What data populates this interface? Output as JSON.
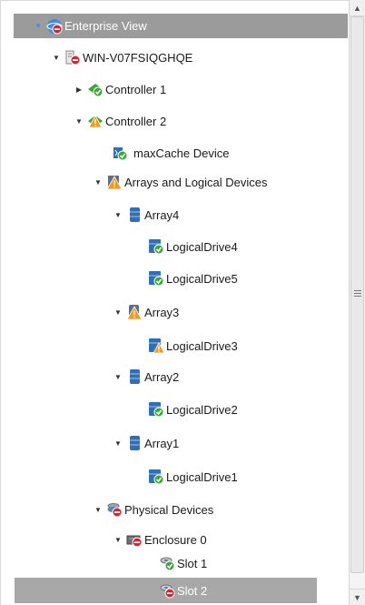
{
  "tree": {
    "root": {
      "label": "Enterprise View",
      "icon": "enterprise-view-icon"
    },
    "server": {
      "label": "WIN-V07FSIQGHQE",
      "icon": "server-error-icon"
    },
    "controller1": {
      "label": "Controller 1",
      "icon": "controller-ok-icon"
    },
    "controller2": {
      "label": "Controller 2",
      "icon": "controller-warning-icon"
    },
    "maxcache": {
      "label": "maxCache Device",
      "icon": "maxcache-device-icon"
    },
    "arrays_group": {
      "label": "Arrays and Logical Devices",
      "icon": "arrays-warning-icon"
    },
    "array4": {
      "label": "Array4",
      "icon": "array-icon"
    },
    "ld4": {
      "label": "LogicalDrive4",
      "icon": "logical-drive-ok-icon"
    },
    "ld5": {
      "label": "LogicalDrive5",
      "icon": "logical-drive-ok-icon"
    },
    "array3": {
      "label": "Array3",
      "icon": "array-warning-icon"
    },
    "ld3": {
      "label": "LogicalDrive3",
      "icon": "logical-drive-warning-icon"
    },
    "array2": {
      "label": "Array2",
      "icon": "array-icon"
    },
    "ld2": {
      "label": "LogicalDrive2",
      "icon": "logical-drive-ok-icon"
    },
    "array1": {
      "label": "Array1",
      "icon": "array-icon"
    },
    "ld1": {
      "label": "LogicalDrive1",
      "icon": "logical-drive-ok-icon"
    },
    "physical": {
      "label": "Physical Devices",
      "icon": "physical-devices-error-icon"
    },
    "enclosure0": {
      "label": "Enclosure 0",
      "icon": "enclosure-error-icon"
    },
    "slot1": {
      "label": "Slot 1",
      "icon": "slot-ok-icon"
    },
    "slot2": {
      "label": "Slot 2",
      "icon": "slot-error-icon"
    }
  },
  "selected_node": "Slot 2",
  "colors": {
    "selection": "#a8a8a8",
    "ok_green": "#3aa635",
    "warning_orange": "#f29a1d",
    "error_red": "#d9232e",
    "array_blue": "#2f6fb6"
  }
}
